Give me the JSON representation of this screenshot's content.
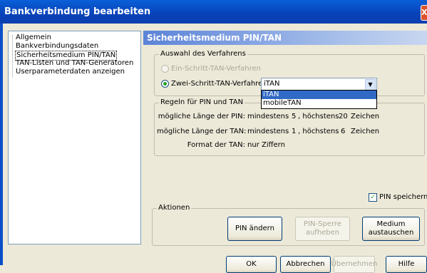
{
  "window": {
    "title": "Bankverbindung bearbeiten",
    "close_label": "X"
  },
  "tree": {
    "items": [
      {
        "label": "Allgemein",
        "selected": false
      },
      {
        "label": "Bankverbindungsdaten",
        "selected": false
      },
      {
        "label": "Sicherheitsmedium PIN/TAN",
        "selected": true
      },
      {
        "label": "TAN-Listen und TAN-Generatoren",
        "selected": false
      },
      {
        "label": "Userparameterdaten anzeigen",
        "selected": false
      }
    ]
  },
  "panel": {
    "title": "Sicherheitsmedium PIN/TAN",
    "verfahren": {
      "legend": "Auswahl des Verfahrens",
      "one_step": "Ein-Schritt-TAN-Verfahren",
      "two_step": "Zwei-Schritt-TAN-Verfahren",
      "combo_value": "iTAN",
      "combo_options": [
        "iTAN",
        "mobileTAN"
      ]
    },
    "regeln": {
      "legend": "Regeln für PIN und TAN",
      "pin_label": "mögliche Länge der PIN:",
      "pin_min_label": "mindestens",
      "pin_min": "5",
      "pin_max_label": ", höchstens",
      "pin_max": "20",
      "pin_unit": "Zeichen",
      "tan_label": "mögliche Länge der TAN:",
      "tan_min_label": "mindestens",
      "tan_min": "1",
      "tan_max_label": ", höchstens",
      "tan_max": "6",
      "tan_unit": "Zeichen",
      "format_label": "Format der TAN:",
      "format_value": "nur Ziffern"
    },
    "pin_speichern": "PIN speichern",
    "aktionen": {
      "legend": "Aktionen",
      "pin_aendern": "PIN ändern",
      "pin_sperre_line1": "PIN-Sperre",
      "pin_sperre_line2": "aufheben",
      "medium_line1": "Medium",
      "medium_line2": "austauschen"
    }
  },
  "footer": {
    "ok": "OK",
    "abbrechen": "Abbrechen",
    "uebernehmen": "Übernehmen",
    "hilfe": "Hilfe"
  }
}
